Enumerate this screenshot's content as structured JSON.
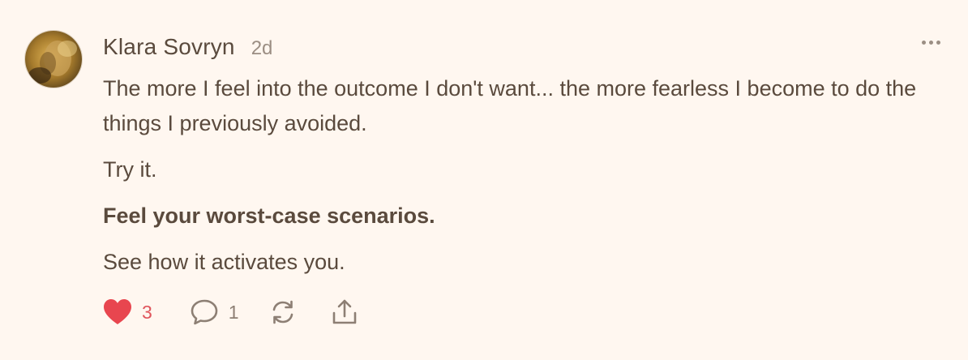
{
  "comment": {
    "author": "Klara Sovryn",
    "time": "2d",
    "paragraphs": [
      "The more I feel into the outcome I don't want... the more fearless I become to do the things I previously avoided.",
      "Try it.",
      "Feel your worst-case scenarios.",
      "See how it activates you."
    ],
    "likes": "3",
    "replies": "1"
  },
  "icons": {
    "avatar": "avatar-photo",
    "more": "more-horizontal-icon",
    "like": "heart-icon",
    "reply": "comment-bubble-icon",
    "restack": "restack-icon",
    "share": "share-icon"
  },
  "colors": {
    "background": "#fff7f0",
    "text": "#5a4a3d",
    "muted": "#9b8e83",
    "like": "#e8464f"
  }
}
